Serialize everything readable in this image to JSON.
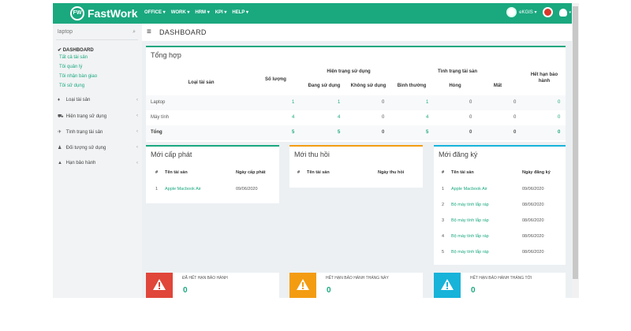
{
  "app": {
    "brand": "FastWork",
    "brand_mark": "FW"
  },
  "topmenu": [
    "OFFICE ▾",
    "WORK ▾",
    "HRM ▾",
    "KPI ▾",
    "HELP ▾"
  ],
  "top_right": {
    "user": "eKGIS ▾",
    "colors": {
      "accent": "#1aa87f",
      "red": "#d9372b"
    }
  },
  "search": {
    "value": "laptop",
    "placeholder": "laptop"
  },
  "sidebar": {
    "section": "✔ DASHBOARD",
    "links": [
      "Tất cả tài sản",
      "Tôi quản lý",
      "Tôi nhận bàn giao",
      "Tôi sử dụng"
    ],
    "menu": [
      {
        "icon": "diamond-icon",
        "glyph": "♦",
        "label": "Loại tài sản"
      },
      {
        "icon": "car-icon",
        "glyph": "⛟",
        "label": "Hiện trạng sử dụng"
      },
      {
        "icon": "plane-icon",
        "glyph": "✈",
        "label": "Tình trạng tài sản"
      },
      {
        "icon": "user-icon",
        "glyph": "♟",
        "label": "Đối tượng sử dụng"
      },
      {
        "icon": "warning-icon",
        "glyph": "▲",
        "label": "Hạn bảo hành"
      }
    ]
  },
  "header": {
    "title": "DASHBOARD"
  },
  "summary": {
    "title": "Tổng hợp",
    "h_asset_type": "Loại tài sản",
    "h_quantity": "Số lượng",
    "h_usage": "Hiện trạng sử dụng",
    "h_in_use": "Đang sử dụng",
    "h_not_in_use": "Không sử dụng",
    "h_condition": "Tình trạng tài sản",
    "h_normal": "Bình thường",
    "h_broken": "Hỏng",
    "h_lost": "Mất",
    "h_warranty1": "Hết hạn bảo",
    "h_warranty2": "hành",
    "rows": [
      {
        "name": "Laptop",
        "qty": "1",
        "in_use": "1",
        "not_in_use": "0",
        "normal": "1",
        "broken": "0",
        "lost": "0",
        "expired": "0"
      },
      {
        "name": "Máy tính",
        "qty": "4",
        "in_use": "4",
        "not_in_use": "0",
        "normal": "4",
        "broken": "0",
        "lost": "0",
        "expired": "0"
      },
      {
        "name": "Tổng",
        "qty": "5",
        "in_use": "5",
        "not_in_use": "0",
        "normal": "5",
        "broken": "0",
        "lost": "0",
        "expired": "0"
      }
    ]
  },
  "new_issued": {
    "title": "Mới cấp phát",
    "h_no": "#",
    "h_name": "Tên tài sản",
    "h_date": "Ngày cấp phát",
    "rows": [
      {
        "no": "1",
        "name": "Apple Macbook Air",
        "date": "09/06/2020"
      }
    ]
  },
  "new_recalled": {
    "title": "Mới thu hồi",
    "h_no": "#",
    "h_name": "Tên tài sản",
    "h_date": "Ngày thu hồi"
  },
  "new_registered": {
    "title": "Mới đăng ký",
    "h_no": "#",
    "h_name": "Tên tài sản",
    "h_date": "Ngày đăng ký",
    "rows": [
      {
        "no": "1",
        "name": "Apple Macbook Air",
        "date": "09/06/2020"
      },
      {
        "no": "2",
        "name": "Bộ máy tính lắp ráp",
        "date": "08/06/2020"
      },
      {
        "no": "3",
        "name": "Bộ máy tính lắp ráp",
        "date": "08/06/2020"
      },
      {
        "no": "4",
        "name": "Bộ máy tính lắp ráp",
        "date": "08/06/2020"
      },
      {
        "no": "5",
        "name": "Bộ máy tính lắp ráp",
        "date": "08/06/2020"
      }
    ]
  },
  "alerts": [
    {
      "label": "ĐÃ HẾT HẠN BẢO HÀNH",
      "count": "0",
      "color": "#e0463a"
    },
    {
      "label": "HẾT HẠN BẢO HÀNH THÁNG NÀY",
      "count": "0",
      "color": "#f39c12"
    },
    {
      "label": "HẾT HẠN BẢO HÀNH THÁNG TỚI",
      "count": "0",
      "color": "#17b3d9"
    }
  ]
}
